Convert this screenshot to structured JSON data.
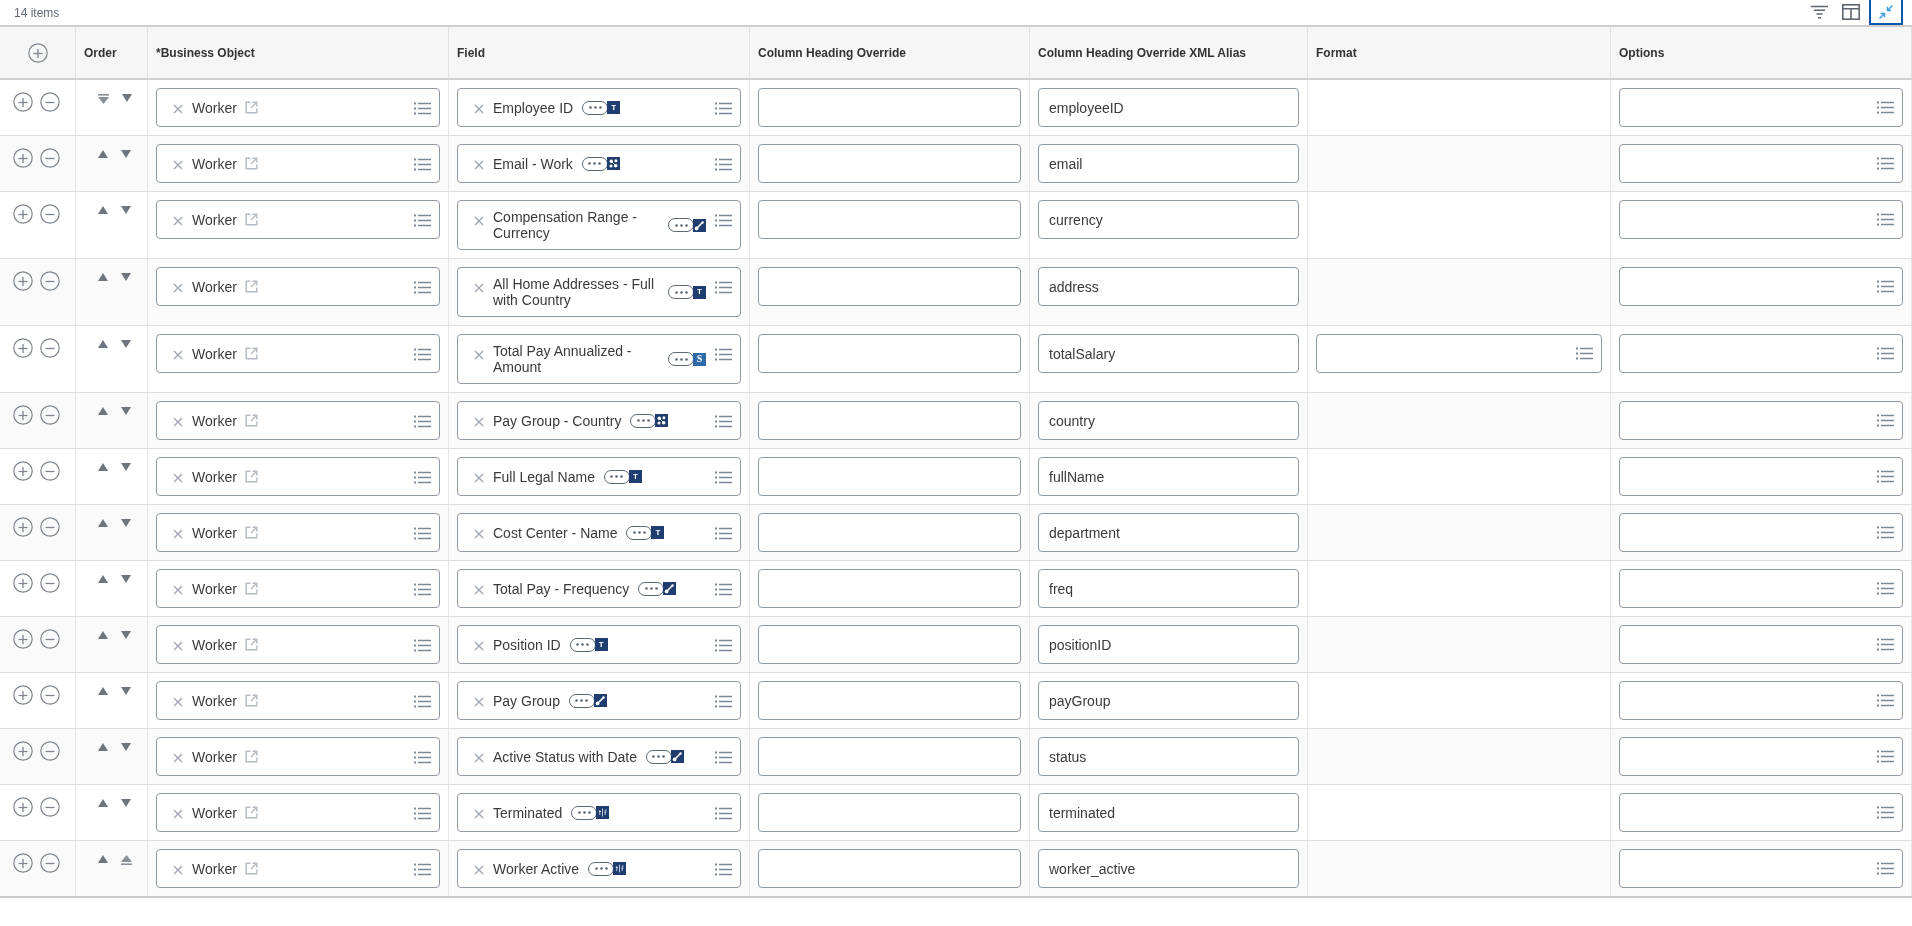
{
  "toolbar": {
    "count": "14 items",
    "buttons": [
      {
        "kind": "filter",
        "focused": false
      },
      {
        "kind": "columns",
        "focused": false
      },
      {
        "kind": "collapse",
        "focused": true
      }
    ]
  },
  "table": {
    "columns": [
      "Order",
      "*Business Object",
      "Field",
      "Column Heading Override",
      "Column Heading Override XML Alias",
      "Format",
      "Options"
    ],
    "rows": [
      {
        "up_at_limit": true,
        "down_at_limit": false,
        "business_object": "Worker",
        "field": {
          "label": "Employee ID",
          "badge": {
            "kind": "text",
            "label": "T"
          }
        },
        "xml_alias": "employeeID",
        "format_field_shown": false
      },
      {
        "up_at_limit": false,
        "down_at_limit": false,
        "business_object": "Worker",
        "field": {
          "label": "Email - Work",
          "badge": {
            "kind": "multi"
          }
        },
        "xml_alias": "email",
        "format_field_shown": false
      },
      {
        "up_at_limit": false,
        "down_at_limit": false,
        "business_object": "Worker",
        "field": {
          "label": "Compensation Range - Currency",
          "badge": {
            "kind": "single"
          }
        },
        "xml_alias": "currency",
        "format_field_shown": false
      },
      {
        "up_at_limit": false,
        "down_at_limit": false,
        "business_object": "Worker",
        "field": {
          "label": "All Home Addresses - Full with Country",
          "badge": {
            "kind": "text",
            "label": "T"
          }
        },
        "xml_alias": "address",
        "format_field_shown": false
      },
      {
        "up_at_limit": false,
        "down_at_limit": false,
        "business_object": "Worker",
        "field": {
          "label": "Total Pay Annualized - Amount",
          "badge": {
            "kind": "currency",
            "label": "S"
          }
        },
        "xml_alias": "totalSalary",
        "format_field_shown": true
      },
      {
        "up_at_limit": false,
        "down_at_limit": false,
        "business_object": "Worker",
        "field": {
          "label": "Pay Group - Country",
          "badge": {
            "kind": "multi"
          }
        },
        "xml_alias": "country",
        "format_field_shown": false
      },
      {
        "up_at_limit": false,
        "down_at_limit": false,
        "business_object": "Worker",
        "field": {
          "label": "Full Legal Name",
          "badge": {
            "kind": "text",
            "label": "T"
          }
        },
        "xml_alias": "fullName",
        "format_field_shown": false
      },
      {
        "up_at_limit": false,
        "down_at_limit": false,
        "business_object": "Worker",
        "field": {
          "label": "Cost Center - Name",
          "badge": {
            "kind": "text",
            "label": "T"
          }
        },
        "xml_alias": "department",
        "format_field_shown": false
      },
      {
        "up_at_limit": false,
        "down_at_limit": false,
        "business_object": "Worker",
        "field": {
          "label": "Total Pay - Frequency",
          "badge": {
            "kind": "single"
          }
        },
        "xml_alias": "freq",
        "format_field_shown": false
      },
      {
        "up_at_limit": false,
        "down_at_limit": false,
        "business_object": "Worker",
        "field": {
          "label": "Position ID",
          "badge": {
            "kind": "text",
            "label": "T"
          }
        },
        "xml_alias": "positionID",
        "format_field_shown": false
      },
      {
        "up_at_limit": false,
        "down_at_limit": false,
        "business_object": "Worker",
        "field": {
          "label": "Pay Group",
          "badge": {
            "kind": "single"
          }
        },
        "xml_alias": "payGroup",
        "format_field_shown": false
      },
      {
        "up_at_limit": false,
        "down_at_limit": false,
        "business_object": "Worker",
        "field": {
          "label": "Active Status with Date",
          "badge": {
            "kind": "single"
          }
        },
        "xml_alias": "status",
        "format_field_shown": false
      },
      {
        "up_at_limit": false,
        "down_at_limit": false,
        "business_object": "Worker",
        "field": {
          "label": "Terminated",
          "badge": {
            "kind": "boolean"
          }
        },
        "xml_alias": "terminated",
        "format_field_shown": false
      },
      {
        "up_at_limit": false,
        "down_at_limit": true,
        "business_object": "Worker",
        "field": {
          "label": "Worker Active",
          "badge": {
            "kind": "boolean"
          }
        },
        "xml_alias": "worker_active",
        "format_field_shown": false
      }
    ]
  }
}
